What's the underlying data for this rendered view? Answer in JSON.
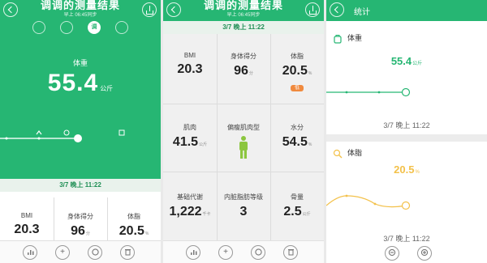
{
  "colors": {
    "green": "#26b673",
    "orange": "#f08a3e",
    "weight_line": "#26b673",
    "fat_line": "#f3c14a",
    "band": "#e9f2ec"
  },
  "panel1": {
    "header": {
      "title": "调调的测量结果",
      "subtitle": "早上 06:45同步"
    },
    "modes": [
      {
        "icon": "running-icon",
        "label": ""
      },
      {
        "icon": "body-icon",
        "label": ""
      },
      {
        "icon": "tune-icon",
        "label": "调"
      },
      {
        "icon": "edit-icon",
        "label": ""
      }
    ],
    "weight_label": "体重",
    "weight_value": "55.4",
    "weight_unit": "公斤",
    "date": "3/7 晚上 11:22",
    "metrics": [
      {
        "label": "BMI",
        "value": "20.3",
        "unit": ""
      },
      {
        "label": "身体得分",
        "value": "96",
        "unit": "分"
      },
      {
        "label": "体脂",
        "value": "20.5",
        "unit": "%"
      }
    ],
    "toolbar": [
      "chart-icon",
      "add-icon",
      "scale-icon",
      "delete-icon"
    ]
  },
  "panel2": {
    "header": {
      "title": "调调的测量结果",
      "subtitle": "早上 06:45同步"
    },
    "date": "3/7 晚上 11:22",
    "metrics": [
      {
        "label": "BMI",
        "value": "20.3",
        "unit": ""
      },
      {
        "label": "身体得分",
        "value": "96",
        "unit": "分"
      },
      {
        "label": "体脂",
        "value": "20.5",
        "unit": "%",
        "tag": "低"
      },
      {
        "label": "肌肉",
        "value": "41.5",
        "unit": "公斤"
      },
      {
        "label": "偏瘦肌肉型",
        "value": "",
        "unit": ""
      },
      {
        "label": "水分",
        "value": "54.5",
        "unit": "%"
      },
      {
        "label": "基础代谢",
        "value": "1,222",
        "unit": "千卡"
      },
      {
        "label": "内脏脂肪等级",
        "value": "3",
        "unit": ""
      },
      {
        "label": "骨量",
        "value": "2.5",
        "unit": "公斤"
      }
    ],
    "toolbar": [
      "chart-icon",
      "add-icon",
      "scale-icon",
      "delete-icon"
    ]
  },
  "panel3": {
    "title": "统计",
    "weight": {
      "label": "体重",
      "value": "55.4",
      "unit": "公斤",
      "date": "3/7 晚上 11:22"
    },
    "fat": {
      "label": "体脂",
      "value": "20.5",
      "unit": "%",
      "date": "3/7 晚上 11:22"
    },
    "zoom": [
      "zoom-out-icon",
      "zoom-in-icon"
    ]
  }
}
